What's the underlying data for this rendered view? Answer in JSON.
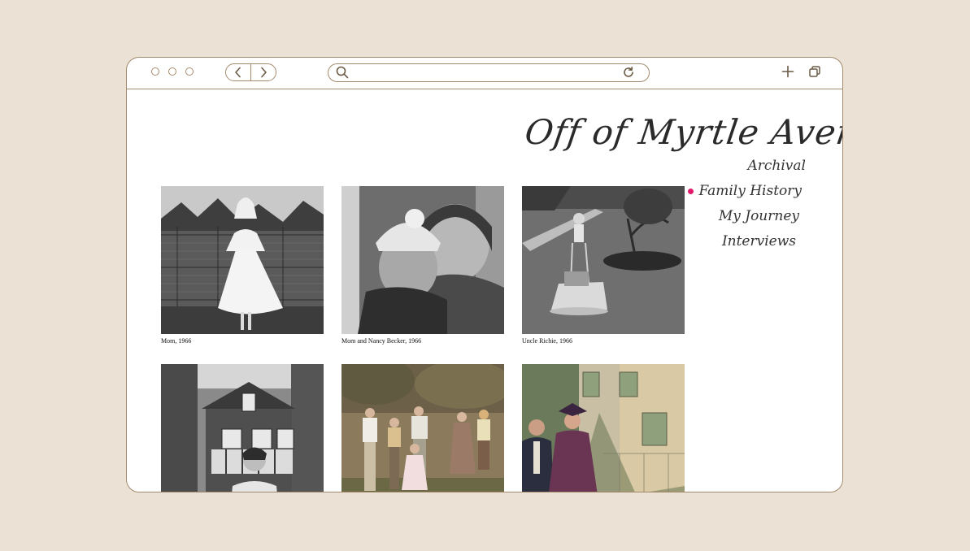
{
  "site": {
    "title": "Off of Myrtle Avenue"
  },
  "nav": [
    {
      "label": "Archival",
      "active": false
    },
    {
      "label": "Family History",
      "active": true
    },
    {
      "label": "My Journey",
      "active": false
    },
    {
      "label": "Interviews",
      "active": false
    }
  ],
  "photos": [
    {
      "caption": "Mom, 1966"
    },
    {
      "caption": "Mom and Nancy Becker, 1966"
    },
    {
      "caption": "Uncle Richie, 1966"
    },
    {
      "caption": ""
    },
    {
      "caption": ""
    },
    {
      "caption": ""
    }
  ],
  "colors": {
    "background": "#ebe2d5",
    "frame": "#a38a6c",
    "accent": "#e0196a"
  },
  "icons": {
    "back": "chevron-left-icon",
    "forward": "chevron-right-icon",
    "search": "search-icon",
    "reload": "reload-icon",
    "new_tab": "plus-icon",
    "tabs": "tabs-icon"
  }
}
